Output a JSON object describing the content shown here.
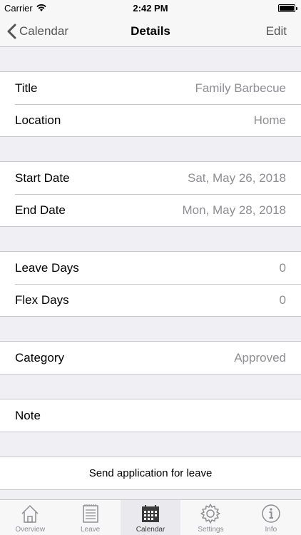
{
  "status": {
    "carrier": "Carrier",
    "time": "2:42 PM"
  },
  "nav": {
    "back_label": "Calendar",
    "title": "Details",
    "edit_label": "Edit"
  },
  "details": {
    "title_label": "Title",
    "title_value": "Family Barbecue",
    "location_label": "Location",
    "location_value": "Home",
    "start_label": "Start Date",
    "start_value": "Sat, May 26, 2018",
    "end_label": "End Date",
    "end_value": "Mon, May 28, 2018",
    "leave_label": "Leave Days",
    "leave_value": "0",
    "flex_label": "Flex Days",
    "flex_value": "0",
    "category_label": "Category",
    "category_value": "Approved",
    "note_label": "Note",
    "send_label": "Send application for leave"
  },
  "tabs": [
    {
      "label": "Overview",
      "icon": "house-icon"
    },
    {
      "label": "Leave",
      "icon": "notepad-icon"
    },
    {
      "label": "Calendar",
      "icon": "calendar-icon"
    },
    {
      "label": "Settings",
      "icon": "gear-icon"
    },
    {
      "label": "Info",
      "icon": "info-icon"
    }
  ],
  "active_tab": "Calendar"
}
